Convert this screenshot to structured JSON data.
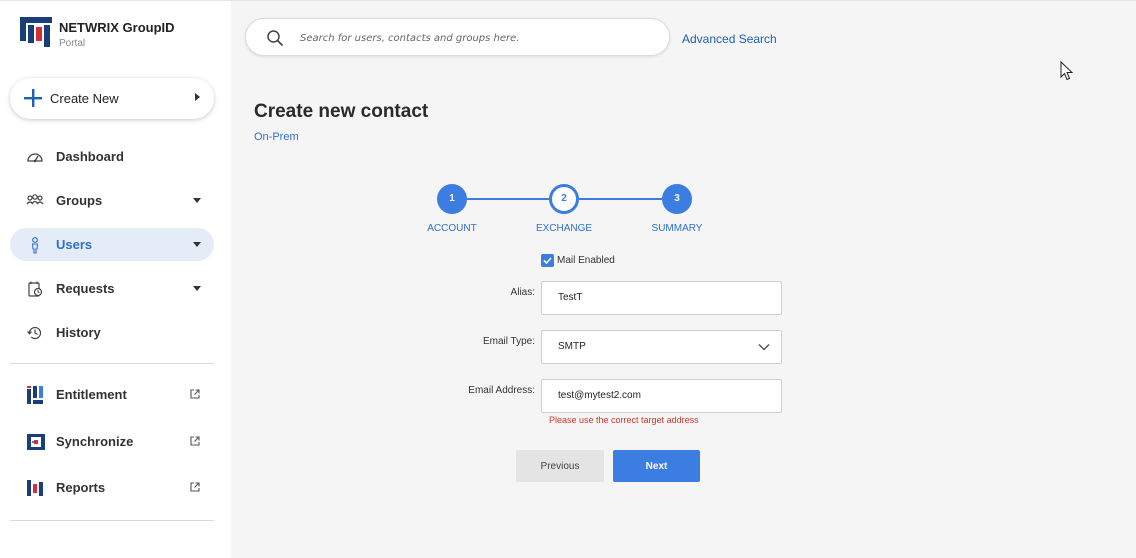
{
  "brand": {
    "title": "NETWRIX GroupID",
    "subtitle": "Portal"
  },
  "sidebar": {
    "create_new": "Create New",
    "items": [
      {
        "label": "Dashboard",
        "icon": "dashboard-icon"
      },
      {
        "label": "Groups",
        "icon": "groups-icon",
        "expandable": true
      },
      {
        "label": "Users",
        "icon": "user-icon",
        "expandable": true,
        "active": true
      },
      {
        "label": "Requests",
        "icon": "requests-icon",
        "expandable": true
      },
      {
        "label": "History",
        "icon": "history-icon"
      }
    ],
    "apps": [
      {
        "label": "Entitlement",
        "icon": "entitlement-icon",
        "external": true
      },
      {
        "label": "Synchronize",
        "icon": "synchronize-icon",
        "external": true
      },
      {
        "label": "Reports",
        "icon": "reports-icon",
        "external": true
      }
    ]
  },
  "search": {
    "placeholder": "Search for users, contacts and groups here.",
    "advanced_label": "Advanced Search"
  },
  "page": {
    "title": "Create new contact",
    "subtitle": "On-Prem"
  },
  "steps": [
    {
      "number": "1",
      "label": "ACCOUNT",
      "state": "completed"
    },
    {
      "number": "2",
      "label": "EXCHANGE",
      "state": "current"
    },
    {
      "number": "3",
      "label": "SUMMARY",
      "state": "upcoming"
    }
  ],
  "form": {
    "mail_enabled_label": "Mail Enabled",
    "mail_enabled": true,
    "alias_label": "Alias:",
    "alias_value": "TestT",
    "email_type_label": "Email Type:",
    "email_type_value": "SMTP",
    "email_address_label": "Email Address:",
    "email_address_value": "test@mytest2.com",
    "email_address_error": "Please use the correct target address"
  },
  "buttons": {
    "previous": "Previous",
    "next": "Next"
  },
  "colors": {
    "accent": "#3b7de0",
    "link": "#2f6fce",
    "error": "#d0342c",
    "active_nav_bg": "#e3ecf7"
  }
}
